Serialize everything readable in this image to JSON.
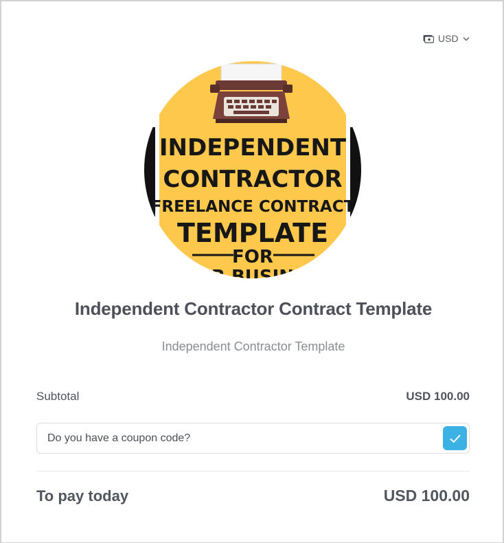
{
  "currency_selector": {
    "value": "USD",
    "icon": "cash-icon"
  },
  "product": {
    "title": "Independent Contractor Contract Template",
    "subtitle": "Independent Contractor Template",
    "cover": {
      "line1": "INDEPENDENT",
      "line2": "CONTRACTOR",
      "line3": "(FREELANCE CONTRACT)",
      "line4": "TEMPLATE",
      "line5": "FOR",
      "line6": "R BUSIN",
      "background_color": "#FEC84C"
    }
  },
  "summary": {
    "subtotal_label": "Subtotal",
    "subtotal_amount": "USD 100.00",
    "coupon_prompt": "Do you have a coupon code?",
    "total_label": "To pay today",
    "total_amount": "USD 100.00"
  },
  "colors": {
    "accent": "#3CB1E3",
    "text": "#4D5058",
    "muted": "#8A8D93"
  }
}
